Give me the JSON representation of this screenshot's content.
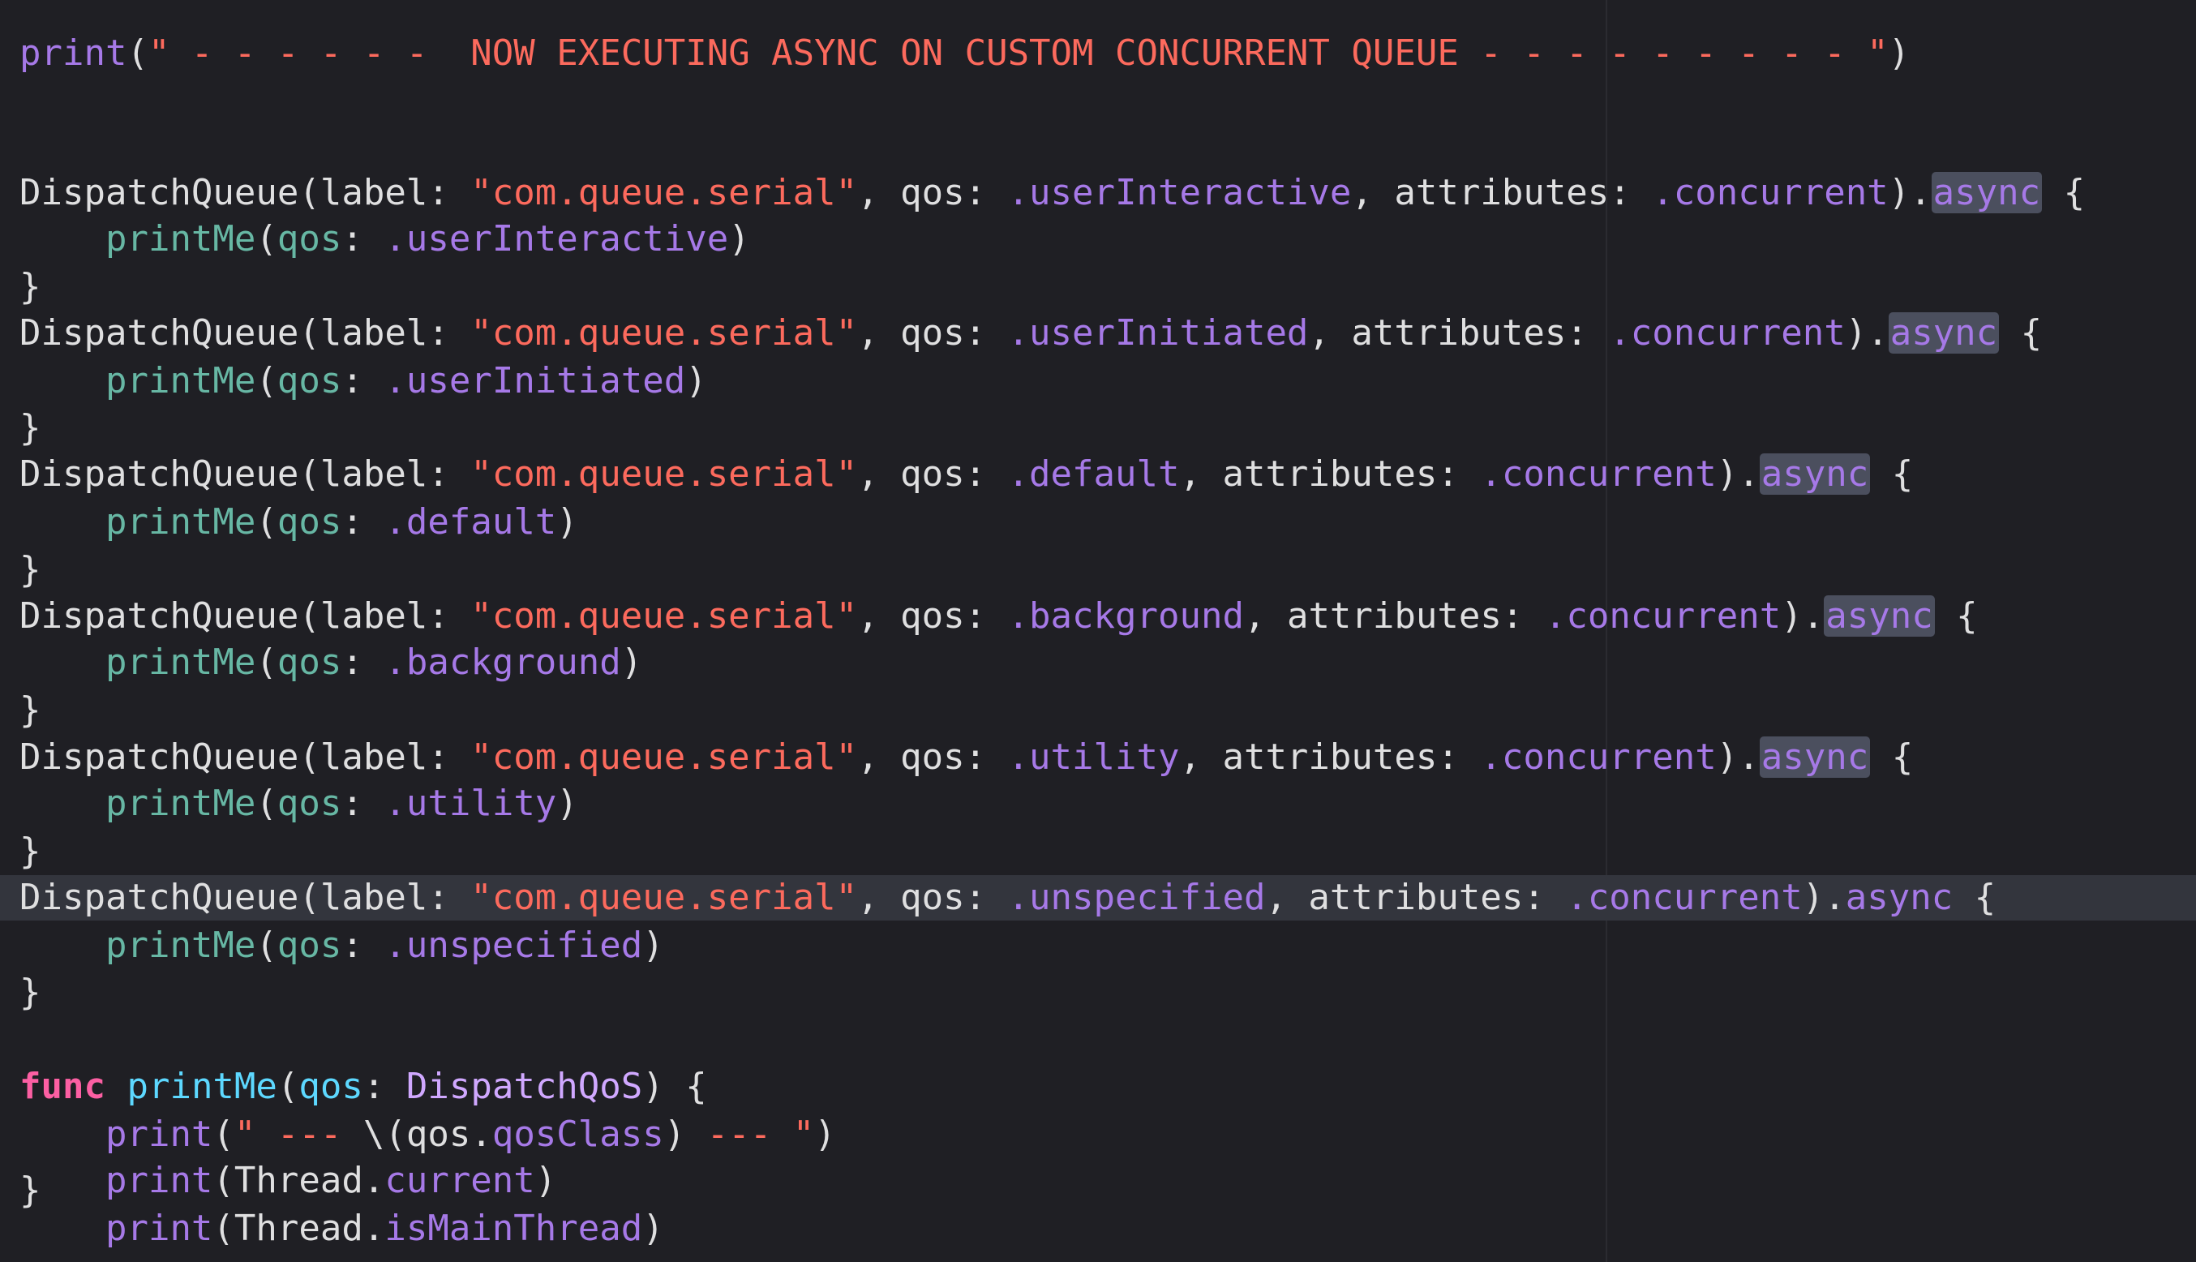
{
  "editor": {
    "theme": {
      "background": "#1f1f24",
      "current_line": "#33353d",
      "text": "#dfdfe0",
      "purple": "#a679e7",
      "string": "#fc6a5d",
      "teal": "#67b7a4",
      "keyword": "#fc5fa3",
      "function_decl": "#5dd8ff"
    },
    "highlighted_line_index": 17,
    "lines": [
      {
        "tokens": [
          {
            "c": "pl",
            "t": "print"
          },
          {
            "c": "plain",
            "t": "("
          },
          {
            "c": "str",
            "t": "\" - - - - - -  NOW EXECUTING ASYNC ON CUSTOM CONCURRENT QUEUE - - - - - - - - - \""
          },
          {
            "c": "plain",
            "t": ")"
          }
        ]
      },
      {
        "tokens": []
      },
      {
        "tokens": [
          {
            "c": "plain",
            "t": "DispatchQueue(label: "
          },
          {
            "c": "str",
            "t": "\"com.queue.serial\""
          },
          {
            "c": "plain",
            "t": ", qos: "
          },
          {
            "c": "pl",
            "t": ".userInteractive"
          },
          {
            "c": "plain",
            "t": ", attributes: "
          },
          {
            "c": "pl",
            "t": ".concurrent"
          },
          {
            "c": "plain",
            "t": ")."
          },
          {
            "c": "pl sel",
            "t": "async"
          },
          {
            "c": "plain",
            "t": " {"
          }
        ]
      },
      {
        "tokens": [
          {
            "c": "plain",
            "t": "    "
          },
          {
            "c": "ent",
            "t": "printMe"
          },
          {
            "c": "plain",
            "t": "("
          },
          {
            "c": "ent",
            "t": "qos"
          },
          {
            "c": "plain",
            "t": ": "
          },
          {
            "c": "pl",
            "t": ".userInteractive"
          },
          {
            "c": "plain",
            "t": ")"
          }
        ]
      },
      {
        "tokens": [
          {
            "c": "plain",
            "t": "}"
          }
        ]
      },
      {
        "tokens": [
          {
            "c": "plain",
            "t": "DispatchQueue(label: "
          },
          {
            "c": "str",
            "t": "\"com.queue.serial\""
          },
          {
            "c": "plain",
            "t": ", qos: "
          },
          {
            "c": "pl",
            "t": ".userInitiated"
          },
          {
            "c": "plain",
            "t": ", attributes: "
          },
          {
            "c": "pl",
            "t": ".concurrent"
          },
          {
            "c": "plain",
            "t": ")."
          },
          {
            "c": "pl sel",
            "t": "async"
          },
          {
            "c": "plain",
            "t": " {"
          }
        ]
      },
      {
        "tokens": [
          {
            "c": "plain",
            "t": "    "
          },
          {
            "c": "ent",
            "t": "printMe"
          },
          {
            "c": "plain",
            "t": "("
          },
          {
            "c": "ent",
            "t": "qos"
          },
          {
            "c": "plain",
            "t": ": "
          },
          {
            "c": "pl",
            "t": ".userInitiated"
          },
          {
            "c": "plain",
            "t": ")"
          }
        ]
      },
      {
        "tokens": [
          {
            "c": "plain",
            "t": "}"
          }
        ]
      },
      {
        "tokens": [
          {
            "c": "plain",
            "t": "DispatchQueue(label: "
          },
          {
            "c": "str",
            "t": "\"com.queue.serial\""
          },
          {
            "c": "plain",
            "t": ", qos: "
          },
          {
            "c": "pl",
            "t": ".default"
          },
          {
            "c": "plain",
            "t": ", attributes: "
          },
          {
            "c": "pl",
            "t": ".concurrent"
          },
          {
            "c": "plain",
            "t": ")."
          },
          {
            "c": "pl sel",
            "t": "async"
          },
          {
            "c": "plain",
            "t": " {"
          }
        ]
      },
      {
        "tokens": [
          {
            "c": "plain",
            "t": "    "
          },
          {
            "c": "ent",
            "t": "printMe"
          },
          {
            "c": "plain",
            "t": "("
          },
          {
            "c": "ent",
            "t": "qos"
          },
          {
            "c": "plain",
            "t": ": "
          },
          {
            "c": "pl",
            "t": ".default"
          },
          {
            "c": "plain",
            "t": ")"
          }
        ]
      },
      {
        "tokens": [
          {
            "c": "plain",
            "t": "}"
          }
        ]
      },
      {
        "tokens": [
          {
            "c": "plain",
            "t": "DispatchQueue(label: "
          },
          {
            "c": "str",
            "t": "\"com.queue.serial\""
          },
          {
            "c": "plain",
            "t": ", qos: "
          },
          {
            "c": "pl",
            "t": ".background"
          },
          {
            "c": "plain",
            "t": ", attributes: "
          },
          {
            "c": "pl",
            "t": ".concurrent"
          },
          {
            "c": "plain",
            "t": ")."
          },
          {
            "c": "pl sel",
            "t": "async"
          },
          {
            "c": "plain",
            "t": " {"
          }
        ]
      },
      {
        "tokens": [
          {
            "c": "plain",
            "t": "    "
          },
          {
            "c": "ent",
            "t": "printMe"
          },
          {
            "c": "plain",
            "t": "("
          },
          {
            "c": "ent",
            "t": "qos"
          },
          {
            "c": "plain",
            "t": ": "
          },
          {
            "c": "pl",
            "t": ".background"
          },
          {
            "c": "plain",
            "t": ")"
          }
        ]
      },
      {
        "tokens": [
          {
            "c": "plain",
            "t": "}"
          }
        ]
      },
      {
        "tokens": [
          {
            "c": "plain",
            "t": "DispatchQueue(label: "
          },
          {
            "c": "str",
            "t": "\"com.queue.serial\""
          },
          {
            "c": "plain",
            "t": ", qos: "
          },
          {
            "c": "pl",
            "t": ".utility"
          },
          {
            "c": "plain",
            "t": ", attributes: "
          },
          {
            "c": "pl",
            "t": ".concurrent"
          },
          {
            "c": "plain",
            "t": ")."
          },
          {
            "c": "pl sel",
            "t": "async"
          },
          {
            "c": "plain",
            "t": " {"
          }
        ]
      },
      {
        "tokens": [
          {
            "c": "plain",
            "t": "    "
          },
          {
            "c": "ent",
            "t": "printMe"
          },
          {
            "c": "plain",
            "t": "("
          },
          {
            "c": "ent",
            "t": "qos"
          },
          {
            "c": "plain",
            "t": ": "
          },
          {
            "c": "pl",
            "t": ".utility"
          },
          {
            "c": "plain",
            "t": ")"
          }
        ]
      },
      {
        "tokens": [
          {
            "c": "plain",
            "t": "}"
          }
        ]
      },
      {
        "tokens": [
          {
            "c": "plain",
            "t": "DispatchQueue(label: "
          },
          {
            "c": "str",
            "t": "\"com.queue.serial\""
          },
          {
            "c": "plain",
            "t": ", qos: "
          },
          {
            "c": "pl",
            "t": ".unspecified"
          },
          {
            "c": "plain",
            "t": ", attributes: "
          },
          {
            "c": "pl",
            "t": ".concurrent"
          },
          {
            "c": "plain",
            "t": ")."
          },
          {
            "c": "pl",
            "t": "async"
          },
          {
            "c": "plain",
            "t": " {"
          }
        ]
      },
      {
        "tokens": [
          {
            "c": "plain",
            "t": "    "
          },
          {
            "c": "ent",
            "t": "printMe"
          },
          {
            "c": "plain",
            "t": "("
          },
          {
            "c": "ent",
            "t": "qos"
          },
          {
            "c": "plain",
            "t": ": "
          },
          {
            "c": "pl",
            "t": ".unspecified"
          },
          {
            "c": "plain",
            "t": ")"
          }
        ]
      },
      {
        "tokens": [
          {
            "c": "plain",
            "t": "}"
          }
        ]
      },
      {
        "tokens": []
      },
      {
        "tokens": [
          {
            "c": "kw",
            "t": "func"
          },
          {
            "c": "plain",
            "t": " "
          },
          {
            "c": "fn",
            "t": "printMe"
          },
          {
            "c": "plain",
            "t": "("
          },
          {
            "c": "fn",
            "t": "qos"
          },
          {
            "c": "plain",
            "t": ": "
          },
          {
            "c": "tp",
            "t": "DispatchQoS"
          },
          {
            "c": "plain",
            "t": ") {"
          }
        ]
      },
      {
        "tokens": [
          {
            "c": "plain",
            "t": "    "
          },
          {
            "c": "pl",
            "t": "print"
          },
          {
            "c": "plain",
            "t": "("
          },
          {
            "c": "str",
            "t": "\" --- "
          },
          {
            "c": "plain",
            "t": "\\(qos."
          },
          {
            "c": "pl",
            "t": "qosClass"
          },
          {
            "c": "plain",
            "t": ") "
          },
          {
            "c": "str",
            "t": "--- \""
          },
          {
            "c": "plain",
            "t": ")"
          }
        ]
      },
      {
        "tokens": [
          {
            "c": "plain",
            "t": "    "
          },
          {
            "c": "pl",
            "t": "print"
          },
          {
            "c": "plain",
            "t": "(Thread."
          },
          {
            "c": "pl",
            "t": "current"
          },
          {
            "c": "plain",
            "t": ")"
          }
        ]
      },
      {
        "tokens": [
          {
            "c": "plain",
            "t": "    "
          },
          {
            "c": "pl",
            "t": "print"
          },
          {
            "c": "plain",
            "t": "(Thread."
          },
          {
            "c": "pl",
            "t": "isMainThread"
          },
          {
            "c": "plain",
            "t": ")"
          }
        ]
      },
      {
        "tokens": [
          {
            "c": "plain",
            "t": "}"
          }
        ]
      }
    ]
  }
}
